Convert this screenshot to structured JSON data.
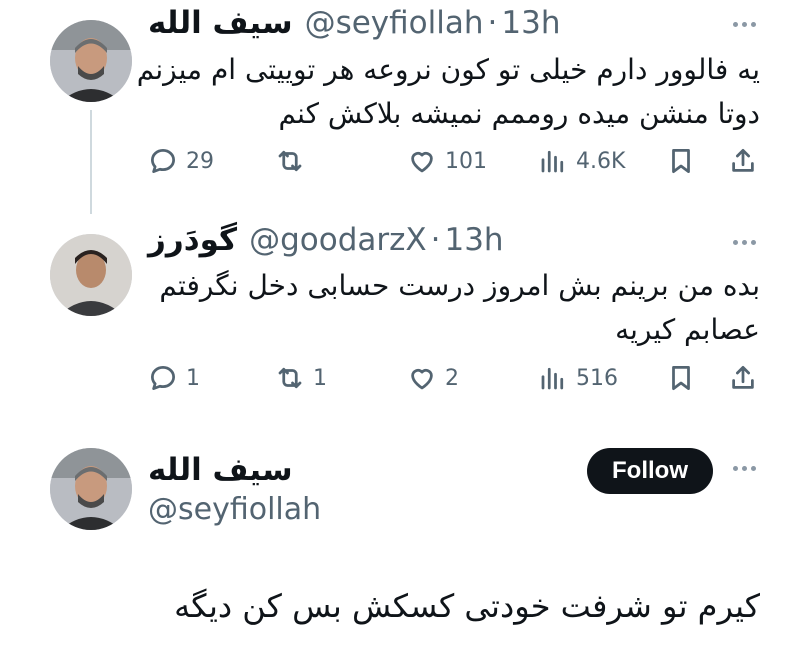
{
  "tweets": [
    {
      "name": "سیف الله",
      "handle": "@seyfiollah",
      "time": "13h",
      "lines": [
        "یه فالوور دارم خیلی تو کون نروعه هر توییتی ام میزنم",
        "دوتا منشن میده روممم نمیشه بلاکش کنم"
      ],
      "replies": "29",
      "retweets": "",
      "likes": "101",
      "views": "4.6K"
    },
    {
      "name": "گودَرز",
      "handle": "@goodarzX",
      "time": "13h",
      "lines": [
        "بده من برینم بش امروز درست حسابی دخل نگرفتم",
        "عصابم کیریه"
      ],
      "replies": "1",
      "retweets": "1",
      "likes": "2",
      "views": "516"
    }
  ],
  "focused": {
    "name": "سیف الله",
    "handle": "@seyfiollah",
    "follow_label": "Follow",
    "text": "کیرم تو شرفت خودتی کسکش بس کن دیگه"
  },
  "colors": {
    "text": "#0f1419",
    "secondary": "#536471",
    "button_bg": "#0f1419",
    "divider": "#cfd9de"
  },
  "icons": [
    "reply-icon",
    "retweet-icon",
    "like-icon",
    "views-icon",
    "bookmark-icon",
    "share-icon",
    "more-icon"
  ]
}
